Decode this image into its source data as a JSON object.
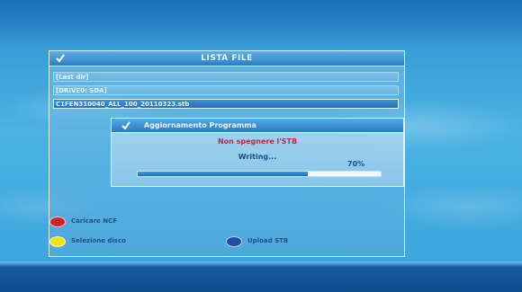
{
  "panel": {
    "title": "LISTA FILE",
    "files": [
      "[Last dir]",
      "[DRIVE0: SDA]",
      "C1FEN310040_ALL_100_20110323.stb"
    ]
  },
  "dialog": {
    "title": "Aggiornamento Programma",
    "warning": "Non spegnere l'STB",
    "status": "Writing...",
    "percent_label": "70%",
    "progress": 0.7
  },
  "legend": {
    "red": {
      "label": "Caricare NCF",
      "color": "#d41e2a"
    },
    "yellow": {
      "label": "Selezione disco",
      "color": "#f2e21c"
    },
    "blue": {
      "label": "Upload STB",
      "color": "#1c4fa0"
    }
  },
  "colors": {
    "accent": "#2c7ec4",
    "warning": "#d0203c"
  }
}
